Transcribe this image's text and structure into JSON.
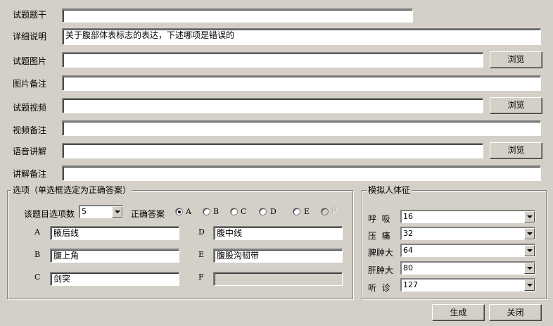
{
  "form": {
    "stem": {
      "label": "试题题干",
      "value": ""
    },
    "detail": {
      "label": "详细说明",
      "value": "关于腹部体表标志的表达，下述哪项是错误的"
    },
    "image": {
      "label": "试题图片",
      "value": "",
      "button": "浏览"
    },
    "image_note": {
      "label": "图片备注",
      "value": ""
    },
    "video": {
      "label": "试题视频",
      "value": "",
      "button": "浏览"
    },
    "video_note": {
      "label": "视频备注",
      "value": ""
    },
    "audio": {
      "label": "语音讲解",
      "value": "",
      "button": "浏览"
    },
    "audio_note": {
      "label": "讲解备注",
      "value": ""
    }
  },
  "options": {
    "title": "选项（单选框选定为正确答案）",
    "count_label": "该题目选项数",
    "count_value": "5",
    "answer_label": "正确答案",
    "radios": [
      {
        "label": "A",
        "checked": true,
        "enabled": true
      },
      {
        "label": "B",
        "checked": false,
        "enabled": true
      },
      {
        "label": "C",
        "checked": false,
        "enabled": true
      },
      {
        "label": "D",
        "checked": false,
        "enabled": true
      },
      {
        "label": "E",
        "checked": false,
        "enabled": true
      },
      {
        "label": "F",
        "checked": false,
        "enabled": false
      }
    ],
    "items": [
      {
        "letter": "A",
        "value": "腋后线",
        "enabled": true
      },
      {
        "letter": "B",
        "value": "腹上角",
        "enabled": true
      },
      {
        "letter": "C",
        "value": "剑突",
        "enabled": true
      },
      {
        "letter": "D",
        "value": "腹中线",
        "enabled": true
      },
      {
        "letter": "E",
        "value": "腹股沟韧带",
        "enabled": true
      },
      {
        "letter": "F",
        "value": "",
        "enabled": false
      }
    ]
  },
  "vitals": {
    "title": "模拟人体征",
    "rows": [
      {
        "label": "呼  吸",
        "value": "16"
      },
      {
        "label": "压  痛",
        "value": "32"
      },
      {
        "label": "脾肿大",
        "value": "64"
      },
      {
        "label": "肝肿大",
        "value": "80"
      },
      {
        "label": "听  诊",
        "value": "127"
      }
    ]
  },
  "actions": {
    "generate": "生成",
    "close": "关闭"
  }
}
